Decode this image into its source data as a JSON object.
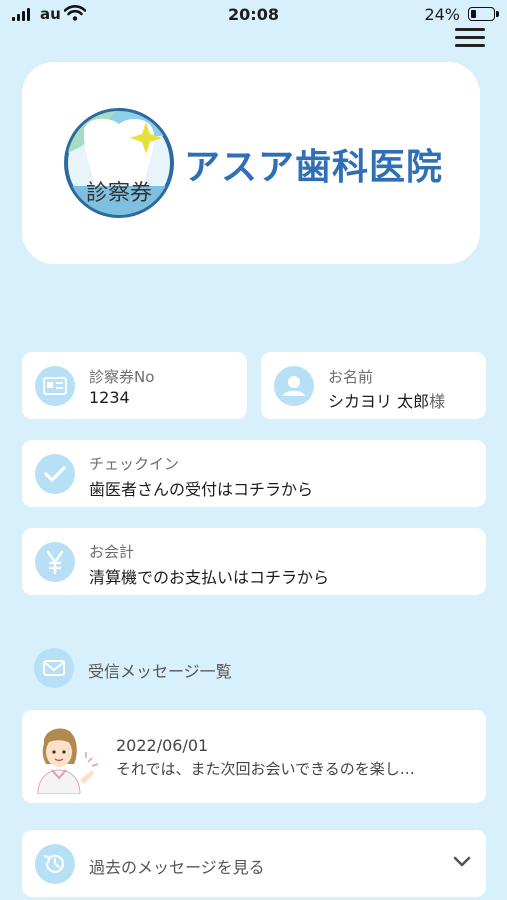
{
  "status_bar": {
    "carrier": "au",
    "time": "20:08",
    "battery_percent": "24%",
    "battery_level": 0.24
  },
  "logo": {
    "emblem_text": "診察券",
    "clinic_name": "アスア歯科医院",
    "brand_color": "#2e6fb5"
  },
  "patient_card": {
    "label": "診察券No",
    "value": "1234"
  },
  "patient_name": {
    "label": "お名前",
    "value": "シカヨリ 太郎",
    "suffix": "様"
  },
  "checkin": {
    "label": "チェックイン",
    "value": "歯医者さんの受付はコチラから"
  },
  "payment": {
    "label": "お会計",
    "value": "清算機でのお支払いはコチラから"
  },
  "inbox": {
    "label": "受信メッセージ一覧"
  },
  "message": {
    "date": "2022/06/01",
    "text": "それでは、また次回お会いできるのを楽し…"
  },
  "history": {
    "label": "過去のメッセージを見る"
  },
  "icons": {
    "menu": "hamburger-icon",
    "patient_card": "id-card-icon",
    "name": "person-icon",
    "checkin": "check-icon",
    "payment": "yen-icon",
    "inbox": "envelope-icon",
    "history": "history-clock-icon",
    "expand": "chevron-down-icon"
  }
}
